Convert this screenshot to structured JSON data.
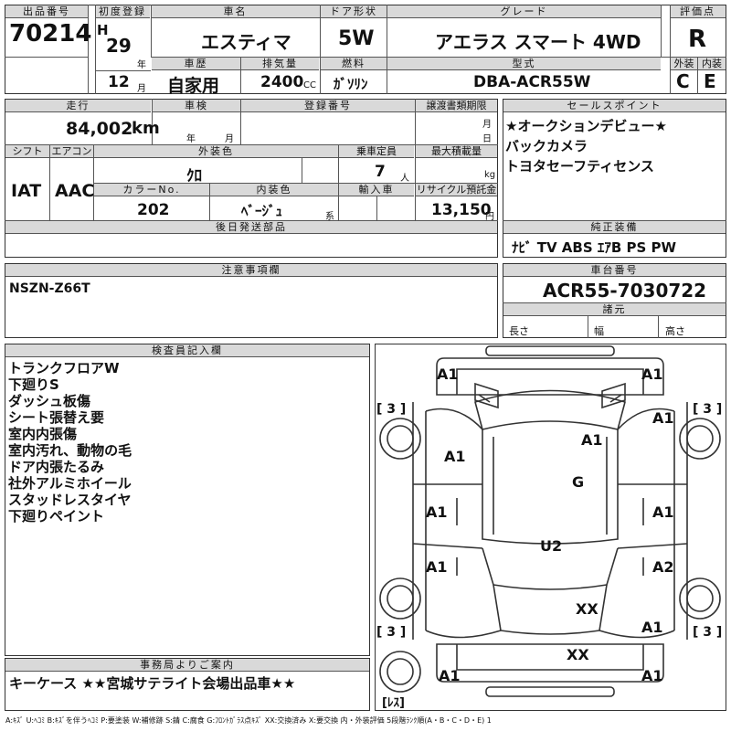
{
  "labels": {
    "lot_no": "出品番号",
    "first_reg": "初度登録",
    "car_name": "車名",
    "door": "ドア形状",
    "grade": "グレード",
    "score": "評価点",
    "history": "車歴",
    "displacement": "排気量",
    "fuel": "燃料",
    "model_code": "型式",
    "exterior": "外装",
    "interior": "内装",
    "mileage": "走行",
    "inspection": "車検",
    "reg_no": "登録番号",
    "transfer_deadline": "譲渡書類期限",
    "sales_points": "セールスポイント",
    "shift": "シフト",
    "aircon": "エアコン",
    "ext_color": "外装色",
    "capacity": "乗車定員",
    "max_load": "最大積載量",
    "color_no": "カラーNo.",
    "int_color": "内装色",
    "import": "輸入車",
    "recycle": "リサイクル預託金",
    "later_parts": "後日発送部品",
    "genuine_equip": "純正装備",
    "caution": "注意事項欄",
    "chassis_no": "車台番号",
    "dims": "諸元",
    "length": "長さ",
    "width": "幅",
    "height": "高さ",
    "inspector": "検査員記入欄",
    "office_info": "事務局よりご案内"
  },
  "units": {
    "year": "年",
    "month": "月",
    "cc": "CC",
    "km": "km",
    "day": "日",
    "person": "人",
    "kg": "kg",
    "kei": "系",
    "yen": "円"
  },
  "vehicle": {
    "lot_no": "70214",
    "era": "H",
    "year": "29",
    "month": "12",
    "car_name": "エスティマ",
    "door": "5W",
    "grade": "アエラス スマート 4WD",
    "score": "R",
    "history": "自家用",
    "displacement": "2400",
    "fuel": "ｶﾞｿﾘﾝ",
    "model_code": "DBA-ACR55W",
    "exterior_grade": "C",
    "interior_grade": "E",
    "mileage": "84,002",
    "inspection_year": "",
    "inspection_month": "",
    "shift": "IAT",
    "aircon": "AAC",
    "ext_color": "ｸﾛ",
    "capacity": "7",
    "color_no": "202",
    "int_color": "ﾍﾞｰｼﾞｭ",
    "recycle": "13,150",
    "chassis_no": "ACR55-7030722"
  },
  "sales_points": [
    "★オークションデビュー★",
    "バックカメラ",
    "トヨタセーフティセンス"
  ],
  "equipment": "ﾅﾋﾞ TV ABS ｴｱB PS PW",
  "caution_text": "NSZN-Z66T",
  "inspector_notes": [
    "トランクフロアW",
    "下廻りS",
    "ダッシュ板傷",
    "シート張替え要",
    "室内内張傷",
    "室内汚れ、動物の毛",
    "ドア内張たるみ",
    "社外アルミホイール",
    "スタッドレスタイヤ",
    "下廻りペイント"
  ],
  "office_message": "キーケース ★★宮城サテライト会場出品車★★",
  "diagram": {
    "marks": [
      "A1",
      "A1",
      "A1",
      "A1",
      "A1",
      "A1",
      "A1",
      "A1",
      "A1",
      "A1",
      "A2",
      "A1",
      "A1",
      "G",
      "U2",
      "XX",
      "XX",
      "A1"
    ],
    "tire_left_top": "[ 3 ]",
    "tire_right_top": "[ 3 ]",
    "tire_left_bottom": "[ 3 ]",
    "tire_right_bottom": "[ 3 ]",
    "spare": "[ﾚｽ]"
  },
  "legend": "A:ｷｽﾞ U:ﾍｺﾐ B:ｷｽﾞを伴うﾍｺﾐ P:要塗装 W:補修跡 S:錆 C:腐食 G:ﾌﾛﾝﾄｶﾞﾗｽ点ｷｽﾞ XX:交換済み X:要交換 内・外装評価 5段階ﾗﾝｸ順(A・B・C・D・E) 1"
}
